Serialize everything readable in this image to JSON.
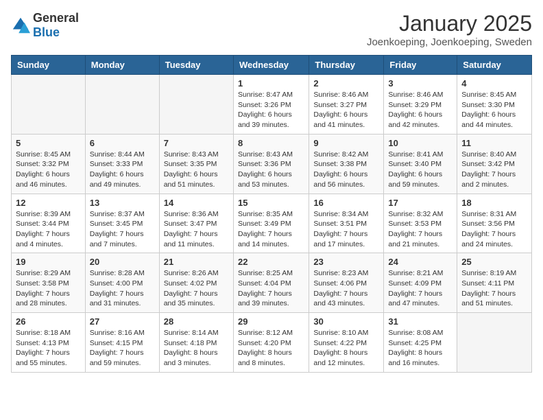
{
  "logo": {
    "general": "General",
    "blue": "Blue"
  },
  "title": "January 2025",
  "location": "Joenkoeping, Joenkoeping, Sweden",
  "days_of_week": [
    "Sunday",
    "Monday",
    "Tuesday",
    "Wednesday",
    "Thursday",
    "Friday",
    "Saturday"
  ],
  "weeks": [
    [
      {
        "day": "",
        "info": ""
      },
      {
        "day": "",
        "info": ""
      },
      {
        "day": "",
        "info": ""
      },
      {
        "day": "1",
        "info": "Sunrise: 8:47 AM\nSunset: 3:26 PM\nDaylight: 6 hours and 39 minutes."
      },
      {
        "day": "2",
        "info": "Sunrise: 8:46 AM\nSunset: 3:27 PM\nDaylight: 6 hours and 41 minutes."
      },
      {
        "day": "3",
        "info": "Sunrise: 8:46 AM\nSunset: 3:29 PM\nDaylight: 6 hours and 42 minutes."
      },
      {
        "day": "4",
        "info": "Sunrise: 8:45 AM\nSunset: 3:30 PM\nDaylight: 6 hours and 44 minutes."
      }
    ],
    [
      {
        "day": "5",
        "info": "Sunrise: 8:45 AM\nSunset: 3:32 PM\nDaylight: 6 hours and 46 minutes."
      },
      {
        "day": "6",
        "info": "Sunrise: 8:44 AM\nSunset: 3:33 PM\nDaylight: 6 hours and 49 minutes."
      },
      {
        "day": "7",
        "info": "Sunrise: 8:43 AM\nSunset: 3:35 PM\nDaylight: 6 hours and 51 minutes."
      },
      {
        "day": "8",
        "info": "Sunrise: 8:43 AM\nSunset: 3:36 PM\nDaylight: 6 hours and 53 minutes."
      },
      {
        "day": "9",
        "info": "Sunrise: 8:42 AM\nSunset: 3:38 PM\nDaylight: 6 hours and 56 minutes."
      },
      {
        "day": "10",
        "info": "Sunrise: 8:41 AM\nSunset: 3:40 PM\nDaylight: 6 hours and 59 minutes."
      },
      {
        "day": "11",
        "info": "Sunrise: 8:40 AM\nSunset: 3:42 PM\nDaylight: 7 hours and 2 minutes."
      }
    ],
    [
      {
        "day": "12",
        "info": "Sunrise: 8:39 AM\nSunset: 3:44 PM\nDaylight: 7 hours and 4 minutes."
      },
      {
        "day": "13",
        "info": "Sunrise: 8:37 AM\nSunset: 3:45 PM\nDaylight: 7 hours and 7 minutes."
      },
      {
        "day": "14",
        "info": "Sunrise: 8:36 AM\nSunset: 3:47 PM\nDaylight: 7 hours and 11 minutes."
      },
      {
        "day": "15",
        "info": "Sunrise: 8:35 AM\nSunset: 3:49 PM\nDaylight: 7 hours and 14 minutes."
      },
      {
        "day": "16",
        "info": "Sunrise: 8:34 AM\nSunset: 3:51 PM\nDaylight: 7 hours and 17 minutes."
      },
      {
        "day": "17",
        "info": "Sunrise: 8:32 AM\nSunset: 3:53 PM\nDaylight: 7 hours and 21 minutes."
      },
      {
        "day": "18",
        "info": "Sunrise: 8:31 AM\nSunset: 3:56 PM\nDaylight: 7 hours and 24 minutes."
      }
    ],
    [
      {
        "day": "19",
        "info": "Sunrise: 8:29 AM\nSunset: 3:58 PM\nDaylight: 7 hours and 28 minutes."
      },
      {
        "day": "20",
        "info": "Sunrise: 8:28 AM\nSunset: 4:00 PM\nDaylight: 7 hours and 31 minutes."
      },
      {
        "day": "21",
        "info": "Sunrise: 8:26 AM\nSunset: 4:02 PM\nDaylight: 7 hours and 35 minutes."
      },
      {
        "day": "22",
        "info": "Sunrise: 8:25 AM\nSunset: 4:04 PM\nDaylight: 7 hours and 39 minutes."
      },
      {
        "day": "23",
        "info": "Sunrise: 8:23 AM\nSunset: 4:06 PM\nDaylight: 7 hours and 43 minutes."
      },
      {
        "day": "24",
        "info": "Sunrise: 8:21 AM\nSunset: 4:09 PM\nDaylight: 7 hours and 47 minutes."
      },
      {
        "day": "25",
        "info": "Sunrise: 8:19 AM\nSunset: 4:11 PM\nDaylight: 7 hours and 51 minutes."
      }
    ],
    [
      {
        "day": "26",
        "info": "Sunrise: 8:18 AM\nSunset: 4:13 PM\nDaylight: 7 hours and 55 minutes."
      },
      {
        "day": "27",
        "info": "Sunrise: 8:16 AM\nSunset: 4:15 PM\nDaylight: 7 hours and 59 minutes."
      },
      {
        "day": "28",
        "info": "Sunrise: 8:14 AM\nSunset: 4:18 PM\nDaylight: 8 hours and 3 minutes."
      },
      {
        "day": "29",
        "info": "Sunrise: 8:12 AM\nSunset: 4:20 PM\nDaylight: 8 hours and 8 minutes."
      },
      {
        "day": "30",
        "info": "Sunrise: 8:10 AM\nSunset: 4:22 PM\nDaylight: 8 hours and 12 minutes."
      },
      {
        "day": "31",
        "info": "Sunrise: 8:08 AM\nSunset: 4:25 PM\nDaylight: 8 hours and 16 minutes."
      },
      {
        "day": "",
        "info": ""
      }
    ]
  ]
}
